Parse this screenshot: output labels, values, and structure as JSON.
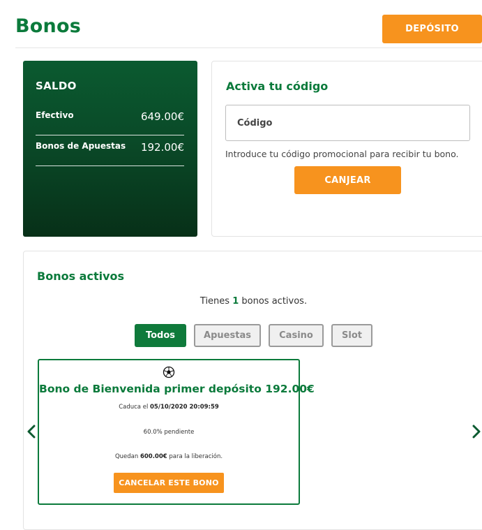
{
  "header": {
    "title": "Bonos",
    "deposit_label": "DEPÓSITO"
  },
  "balance": {
    "title": "SALDO",
    "rows": [
      {
        "label": "Efectivo",
        "value": "649.00€"
      },
      {
        "label": "Bonos de Apuestas",
        "value": "192.00€"
      }
    ]
  },
  "promo": {
    "title": "Activa tu código",
    "input_placeholder": "Código",
    "input_value": "",
    "help_text": "Introduce tu código promocional para recibir tu bono.",
    "redeem_label": "CANJEAR"
  },
  "active": {
    "title": "Bonos activos",
    "summary_prefix": "Tienes",
    "summary_count": "1",
    "summary_suffix": "bonos activos.",
    "filters": [
      "Todos",
      "Apuestas",
      "Casino",
      "Slot"
    ],
    "selected_filter": "Todos"
  },
  "bonus_card": {
    "icon": "soccer-ball-icon",
    "title": "Bono de Bienvenida primer depósito 192.00€",
    "expiry_prefix": "Caduca el",
    "expiry_date": "05/10/2020 20:09:59",
    "pending_text": "60.0% pendiente",
    "remaining_prefix": "Quedan",
    "remaining_amount": "600.00€",
    "remaining_suffix": "para la liberación.",
    "cancel_label": "CANCELAR ESTE BONO"
  },
  "colors": {
    "brand_green": "#0b7a3b",
    "accent_orange": "#f7931e",
    "card_dark_green": "#0a4a28"
  }
}
